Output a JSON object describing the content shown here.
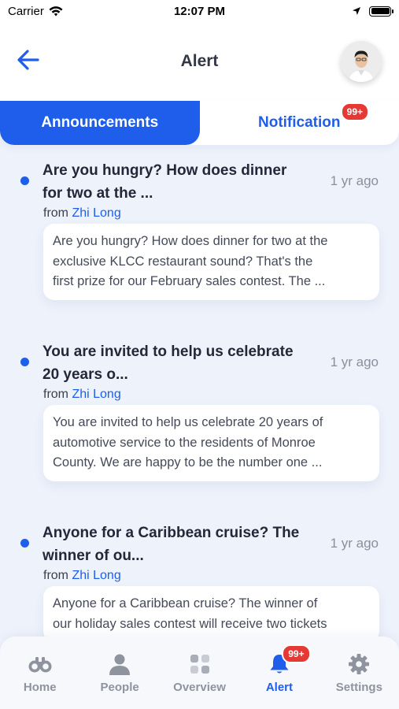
{
  "status_bar": {
    "carrier": "Carrier",
    "time": "12:07 PM"
  },
  "header": {
    "title": "Alert"
  },
  "tabs": [
    {
      "label": "Announcements",
      "active": true
    },
    {
      "label": "Notification",
      "active": false,
      "badge": "99+"
    }
  ],
  "announcements": [
    {
      "title_line1": "Are you hungry? How does dinner",
      "title_line2": "for two at the ...",
      "time": "1 yr ago",
      "from_label": "from",
      "author": "Zhi Long",
      "preview_line1": "Are you hungry? How does dinner for two at the",
      "preview_line2": "exclusive KLCC restaurant sound? That's the",
      "preview_line3": "first prize for our February sales contest. The ..."
    },
    {
      "title_line1": "You are invited to help us celebrate",
      "title_line2": "20 years o...",
      "time": "1 yr ago",
      "from_label": "from",
      "author": "Zhi Long",
      "preview_line1": "You are invited to help us celebrate 20 years of",
      "preview_line2": "automotive service to the residents of Monroe",
      "preview_line3": "County. We are happy to be the number one ..."
    },
    {
      "title_line1": "Anyone for a Caribbean cruise? The",
      "title_line2": "winner of ou...",
      "time": "1 yr ago",
      "from_label": "from",
      "author": "Zhi Long",
      "preview_line1": "Anyone for a Caribbean cruise? The winner of",
      "preview_line2": "our holiday sales contest will receive two tickets",
      "preview_line3": ""
    }
  ],
  "bottom_nav": [
    {
      "label": "Home",
      "icon": "binoculars-icon"
    },
    {
      "label": "People",
      "icon": "person-icon"
    },
    {
      "label": "Overview",
      "icon": "grid-icon"
    },
    {
      "label": "Alert",
      "icon": "bell-icon",
      "active": true,
      "badge": "99+"
    },
    {
      "label": "Settings",
      "icon": "gear-icon"
    }
  ],
  "colors": {
    "accent": "#1e5eea",
    "badge": "#e53935",
    "background": "#eef2fb"
  }
}
